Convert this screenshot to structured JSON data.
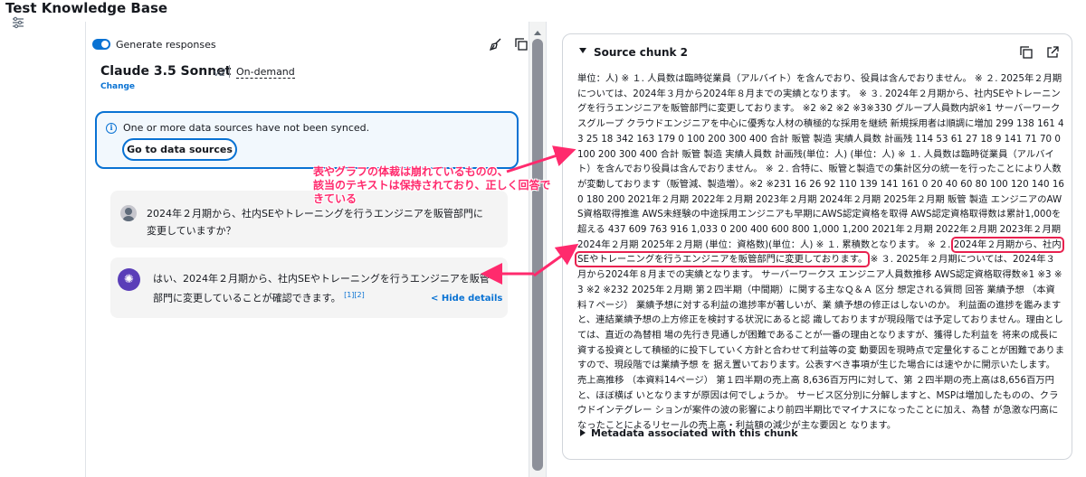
{
  "window": {
    "title": "Test Knowledge Base"
  },
  "chat": {
    "generate_label": "Generate responses",
    "model": {
      "name": "Claude 3.5 Sonnet",
      "version": "v2",
      "mode": "On-demand",
      "change_label": "Change"
    },
    "alert": {
      "text": "One or more data sources have not been synced.",
      "button_label": "Go to data sources"
    },
    "user_message": "2024年２月期から、社内SEやトレーニングを行うエンジニアを販管部門に変更していますか？",
    "bot_message": "はい、2024年２月期から、社内SEやトレーニングを行うエンジニアを販管部門に変更していることが確認できます。",
    "citations": "[1][2]",
    "hide_details_label": "< Hide details"
  },
  "annotation": {
    "line1": "表やグラフの体裁は崩れているものの、",
    "line2": "該当のテキストは保持されており、正しく回答できている",
    "color": "#ff2a6d"
  },
  "source": {
    "title": "Source chunk 2",
    "text_before": "単位：人) ※ １. 人員数は臨時従業員（アルバイト）を含んでおり、役員は含んでおりません。 ※ ２. 2025年２月期については、2024年３月から2024年８月までの実績となります。 ※ ３. 2024年２月期から、社内SEやトレーニングを行うエンジニアを販管部門に変更しております。 ※2 ※2 ※2 ※3※330 グループ人員数内訳※1 サーバーワークスグループ クラウドエンジニアを中心に優秀な人材の積極的な採用を継続 新規採用者は順調に増加 299 138 161 43 25 18 342 163 179 0 100 200 300 400 合計 販管 製造 実績人員数 計画残 114 53 61 27 18 9 141 71 70 0 100 200 300 400 合計 販管 製造 実績人員数 計画残(単位：人) (単位：人) ※ １. 人員数は臨時従業員（アルバイト）を含んでおり役員は含んでおりません。 ※ ２. 合特に、販管と製造での集計区分の統一を行ったことにより人数が変動しております（販管減、製造増）。※2 ※231 16 26 92 110 139 141 161 0 20 40 60 80 100 120 140 160 180 200 2021年２月期 2022年２月期 2023年２月期 2024年２月期 2025年２月期 販管 製造 エンジニアのAWS資格取得推進 AWS未経験の中途採用エンジニアも早期にAWS認定資格を取得 AWS認定資格取得数は累計1,000を超える 437 609 763 916 1,033 0 200 400 600 800 1,000 1,200 2021年２月期 2022年２月期 2023年２月期 2024年２月期 2025年２月期 (単位：資格数)(単位：人) ※ １. 累積数となります。 ※ ２. ",
    "text_highlight": "2024年２月期から、社内SEやトレーニングを行うエンジニアを販管部門に変更しております。",
    "text_after": " ※ ３. 2025年２月期については、2024年３月から2024年８月までの実績となります。 サーバーワークス エンジニア人員数推移 AWS認定資格取得数※1 ※3 ※3 ※2 ※232 2025年２月期 第２四半期（中間期）に関する主なＱ＆Ａ 区分 想定される質問 回答 業績予想 （本資料７ページ） 業績予想に対する利益の進捗率が著しいが、業 績予想の修正はしないのか。 利益面の進捗を鑑みますと、連結業績予想の上方修正を検討する状況にあると認 識しておりますが現段階では予定しておりません。理由としては、直近の為替相 場の先行き見通しが困難であることが一番の理由となりますが、獲得した利益を 将来の成長に資する投資として積極的に投下していく方針と合わせて利益等の変 動要因を現時点で定量化することが困難でありますので、現段階では業績予想 を 据え置いております。公表すべき事項が生じた場合には速やかに開示いたします。 売上高推移 （本資料14ページ） 第１四半期の売上高 8,636百万円に対して、第 ２四半期の売上高は8,656百万円と、ほぼ横ば いとなりますが原因は何でしょうか。 サービス区分別に分解しますと、MSPは増加したものの、クラウドインテグレー ションが案件の波の影響により前四半期比でマイナスになったことに加え、為替 が急激な円高になったことによるリセールの売上高・利益額の減少が主な要因と なります。",
    "metadata_label": "Metadata associated with this chunk"
  },
  "icons": [
    "settings-sliders-icon",
    "broom-icon",
    "copy-icon",
    "external-link-icon",
    "info-icon",
    "user-avatar-icon",
    "assistant-avatar-icon"
  ]
}
